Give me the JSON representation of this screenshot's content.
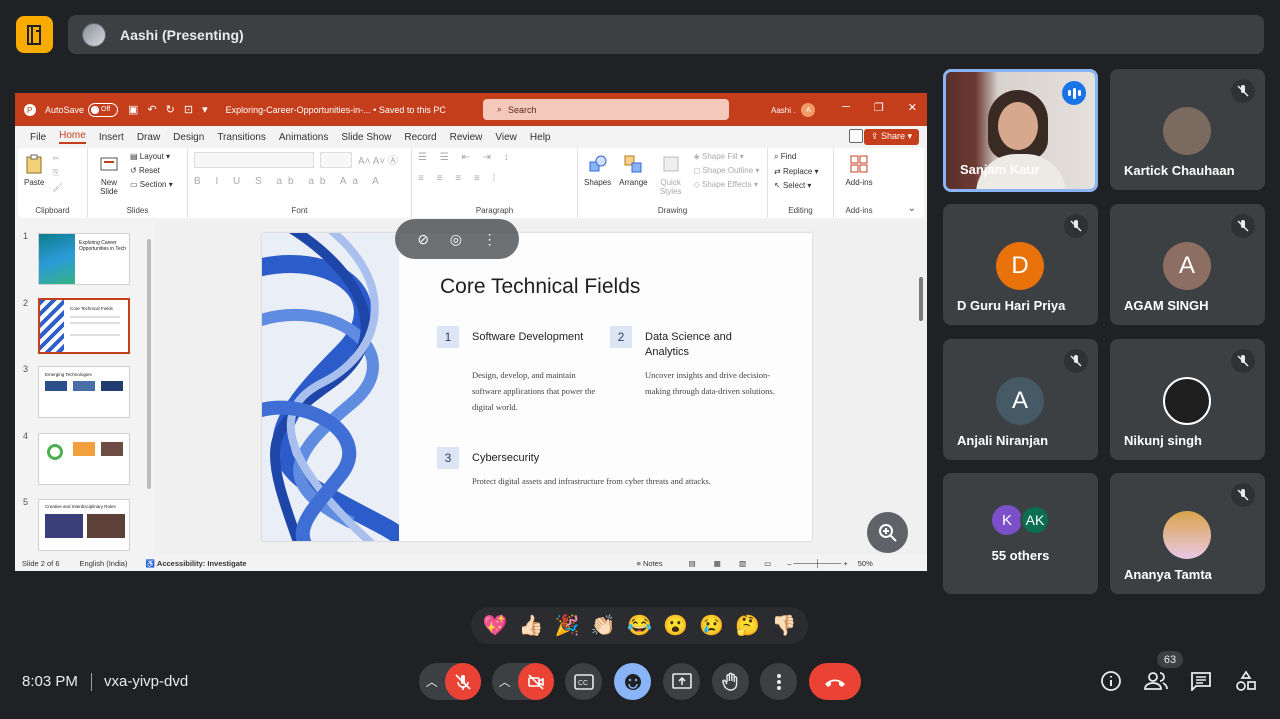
{
  "meet": {
    "presenter": "Aashi (Presenting)",
    "time": "8:03 PM",
    "code": "vxa-yivp-dvd",
    "people_count": "63",
    "others_label": "55 others",
    "others_initials": [
      "K",
      "AK"
    ]
  },
  "ppt": {
    "autosave_label": "AutoSave",
    "autosave_state": "Off",
    "doc_title": "Exploring-Career-Opportunities-in-... • Saved to this PC",
    "search_placeholder": "Search",
    "user_short": "Aashi .",
    "user_initial": "A",
    "tabs": [
      "File",
      "Home",
      "Insert",
      "Draw",
      "Design",
      "Transitions",
      "Animations",
      "Slide Show",
      "Record",
      "Review",
      "View",
      "Help"
    ],
    "share_label": "Share",
    "ribbon": {
      "clipboard": {
        "paste": "Paste",
        "label": "Clipboard"
      },
      "slides": {
        "new_slide": "New Slide",
        "layout": "Layout",
        "reset": "Reset",
        "section": "Section",
        "label": "Slides"
      },
      "font_label": "Font",
      "paragraph_label": "Paragraph",
      "drawing": {
        "shapes": "Shapes",
        "arrange": "Arrange",
        "quick_styles": "Quick Styles",
        "shape_fill": "Shape Fill",
        "shape_outline": "Shape Outline",
        "shape_effects": "Shape Effects",
        "label": "Drawing"
      },
      "editing": {
        "find": "Find",
        "replace": "Replace",
        "select": "Select",
        "label": "Editing"
      },
      "addins": {
        "addins": "Add-ins",
        "label": "Add-ins"
      }
    },
    "thumbnails": [
      {
        "num": "1",
        "title": "Exploring Career Opportunities in Tech"
      },
      {
        "num": "2",
        "title": "Core Technical Fields"
      },
      {
        "num": "3",
        "title": "Emerging Technologies"
      },
      {
        "num": "4",
        "title": ""
      },
      {
        "num": "5",
        "title": "Creative and Interdisciplinary Roles"
      }
    ],
    "slide": {
      "title": "Core Technical Fields",
      "fields": [
        {
          "num": "1",
          "head": "Software Development",
          "desc": "Design, develop, and maintain software applications that power the digital world."
        },
        {
          "num": "2",
          "head": "Data Science and Analytics",
          "desc": "Uncover insights and drive decision-making through data-driven solutions."
        },
        {
          "num": "3",
          "head": "Cybersecurity",
          "desc": "Protect digital assets and infrastructure from cyber threats and attacks."
        }
      ]
    },
    "status": {
      "slide_of": "Slide 2 of 6",
      "language": "English (India)",
      "accessibility": "Accessibility: Investigate",
      "notes": "Notes",
      "zoom": "50%"
    }
  },
  "participants": [
    {
      "name": "Sanjam Kaur",
      "speaking": true
    },
    {
      "name": "Kartick Chauhaan",
      "muted": true
    },
    {
      "name": "D Guru Hari Priya",
      "initial": "D",
      "color": "#e8710a",
      "muted": true
    },
    {
      "name": "AGAM SINGH",
      "initial": "A",
      "color": "#8d6e63",
      "muted": true
    },
    {
      "name": "Anjali Niranjan",
      "initial": "A",
      "color": "#455a64",
      "muted": true
    },
    {
      "name": "Nikunj singh",
      "muted": true
    },
    {
      "name": "Ananya Tamta",
      "muted": true
    }
  ],
  "reactions": [
    "💖",
    "👍🏻",
    "🎉",
    "👏🏻",
    "😂",
    "😮",
    "😢",
    "🤔",
    "👎🏻"
  ],
  "colors": {
    "ppt_accent": "#c43e1c",
    "meet_red": "#ea4335",
    "meet_blue": "#8ab4f8",
    "meet_bg": "#202124"
  }
}
